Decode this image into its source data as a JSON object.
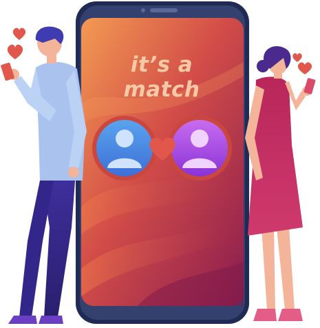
{
  "headline": {
    "line1": "it’s a",
    "line2": "match"
  },
  "icons": {
    "left_avatar": "user-avatar-icon",
    "right_avatar": "user-avatar-icon",
    "center": "heart-icon",
    "floating": "heart-icon"
  },
  "colors": {
    "phone_body": "#1f2a55",
    "screen_top": "#f08a4b",
    "screen_bottom": "#8e1f4f",
    "headline": "#f6c9a6",
    "avatar_left": "#4a8fe0",
    "avatar_right": "#b04de0",
    "heart": "#e2574c"
  }
}
